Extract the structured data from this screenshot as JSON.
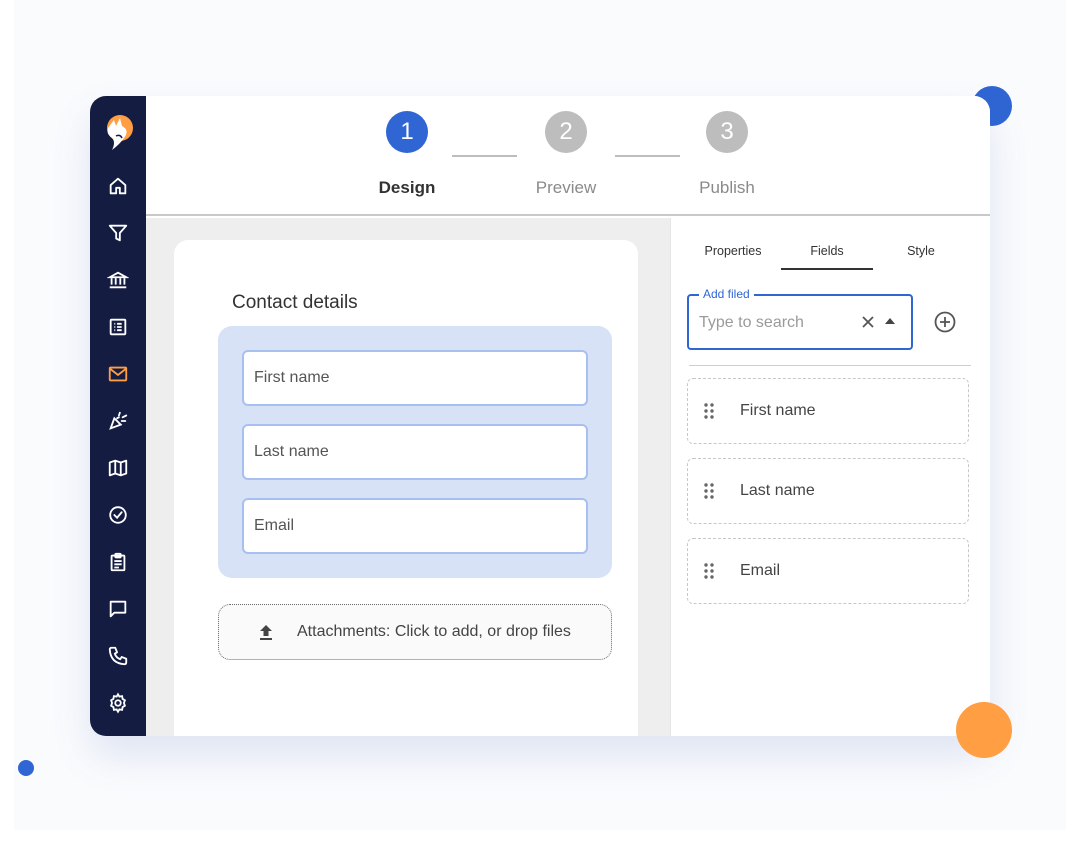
{
  "stepper": {
    "steps": [
      {
        "number": "1",
        "label": "Design"
      },
      {
        "number": "2",
        "label": "Preview"
      },
      {
        "number": "3",
        "label": "Publish"
      }
    ],
    "active_step": 1
  },
  "sidebar": {
    "logo": "fox-logo",
    "icons": [
      "home-icon",
      "filter-icon",
      "bank-icon",
      "list-icon",
      "mail-icon",
      "party-icon",
      "map-icon",
      "check-circle-icon",
      "clipboard-icon",
      "chat-icon",
      "phone-icon",
      "settings-icon"
    ],
    "active_icon": "mail-icon"
  },
  "form": {
    "title": "Contact details",
    "fields": [
      "First name",
      "Last name",
      "Email"
    ],
    "attachments_label": "Attachments: Click to add, or drop files"
  },
  "panel": {
    "tabs": [
      "Properties",
      "Fields",
      "Style"
    ],
    "active_tab": "Fields",
    "search": {
      "legend": "Add filed",
      "placeholder": "Type to search"
    },
    "field_list": [
      "First name",
      "Last name",
      "Email"
    ]
  },
  "colors": {
    "accent_blue": "#2f66d4",
    "accent_orange": "#ff9e42",
    "sidebar_bg": "#141c42",
    "step_inactive": "#bdbdbd",
    "field_group_bg": "#d8e2f6"
  }
}
